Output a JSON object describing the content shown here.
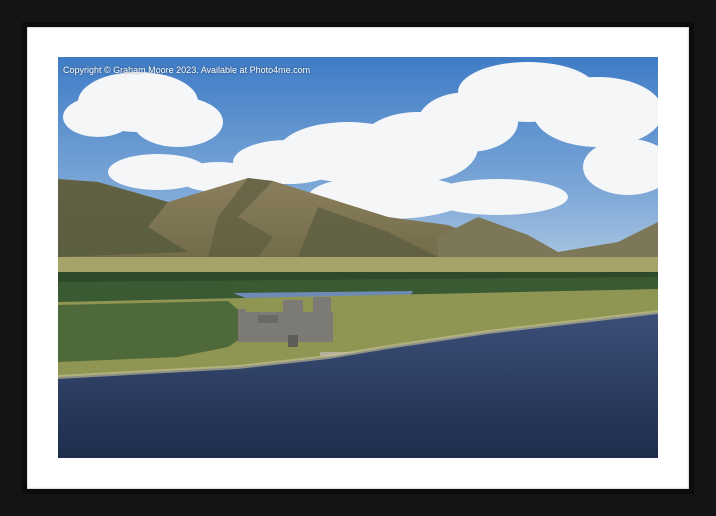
{
  "watermark": {
    "text": "Copyright © Graham Moore 2023. Available at Photo4me.com"
  },
  "colors": {
    "frame": "#141414",
    "mount": "#ffffff",
    "sky": "#5f93cf",
    "loch": "#2c3e64",
    "grass": "#8f9552"
  }
}
